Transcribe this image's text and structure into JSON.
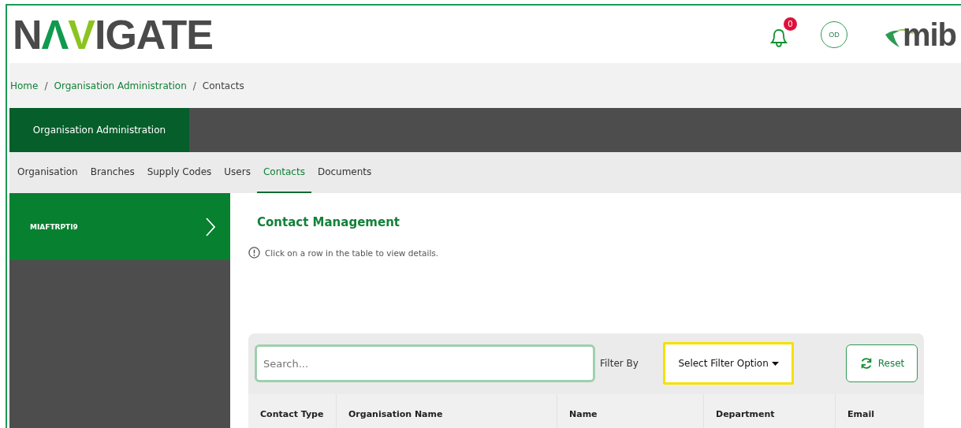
{
  "header": {
    "logo": "NΛVIGATE",
    "notifications": "0",
    "avatar": "OD",
    "brand": "mib"
  },
  "breadcrumb": {
    "separator": "/",
    "items": [
      "Home",
      "Organisation Administration",
      "Contacts"
    ]
  },
  "section_tab": {
    "label": "Organisation Administration",
    "selected": true
  },
  "tabs": [
    {
      "label": "Organisation",
      "selected": false
    },
    {
      "label": "Branches",
      "selected": false
    },
    {
      "label": "Supply Codes",
      "selected": false
    },
    {
      "label": "Users",
      "selected": false
    },
    {
      "label": "Contacts",
      "selected": true
    },
    {
      "label": "Documents",
      "selected": false
    }
  ],
  "sidebar": {
    "items": [
      {
        "label": "MIAFTRPTI9",
        "selected": true
      }
    ]
  },
  "main": {
    "title": "Contact Management",
    "info": "Click on a row in the table to view details.",
    "search": {
      "placeholder": "Search..."
    },
    "filter_label": "Filter By",
    "filter": {
      "label": "Select Filter Option",
      "focused": true
    },
    "reset": "Reset",
    "table": {
      "columns": [
        "Contact Type",
        "Organisation Name",
        "Name",
        "Department",
        "Email"
      ]
    }
  }
}
